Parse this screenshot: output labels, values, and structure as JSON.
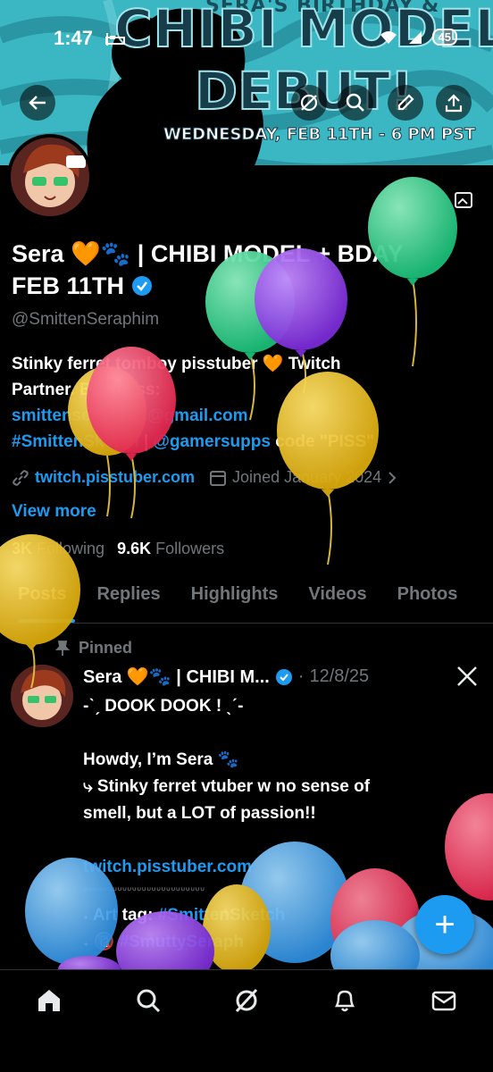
{
  "status": {
    "time": "1:47",
    "battery": "45"
  },
  "banner": {
    "top_text": "SERA'S BIRTHDAY &",
    "title_line1": "CHIBI MODEL",
    "title_line2": "DEBUT!",
    "date_line": "WEDNESDAY, FEB 11TH - 6 PM PST"
  },
  "profile": {
    "name_line1": "Sera 🧡🐾 | CHIBI MODEL + BDAY",
    "name_line2": "FEB 11TH",
    "handle": "@SmittenSeraphim",
    "bio_line1": "Stinky ferret tomboy pisstuber 🧡 Twitch",
    "bio_line2": "Partner. Business:",
    "bio_email": "smittenseraphim@gmail.com",
    "bio_hashtag": "#SmittenSketch",
    "bio_sep": " | ",
    "bio_mention": "@gamersupps",
    "bio_code": " code \"PISS\"",
    "website": "twitch.pisstuber.com",
    "joined": "Joined January 2024",
    "view_more": "View more",
    "following_count": "3K",
    "following_label": "Following",
    "followers_count": "9.6K",
    "followers_label": "Followers"
  },
  "tabs": [
    "Posts",
    "Replies",
    "Highlights",
    "Videos",
    "Photos"
  ],
  "post": {
    "pinned_label": "Pinned",
    "author": "Sera 🧡🐾 | CHIBI M...",
    "dot": "·",
    "date": "12/8/25",
    "line1": "-ˋˏ DOOK DOOK ! ˎˊ-",
    "line2": "Howdy, I’m Sera 🐾",
    "line3": "⤷ Stinky ferret vtuber w no sense of",
    "line4": "smell, but a LOT of passion!!",
    "link": "twitch.pisstuber.com",
    "drips": "ᐡᐡᐡᐡᐡᐡᐡᐡᐡᐡᐡᐡᐡᐡᐡᐡᐡᐡᐡᐡᐡᐡᐡᐡᐡ",
    "art_tag_label": "˖ Art tag: ",
    "art_tag": "#SmittenSketch",
    "nsfw_prefix": "˖ 🔞 ",
    "nsfw_tag": "#SmuttySeraph"
  },
  "fab_label": "+",
  "colors": {
    "accent": "#1d9bf0",
    "muted": "#71767b",
    "background": "#000000"
  }
}
